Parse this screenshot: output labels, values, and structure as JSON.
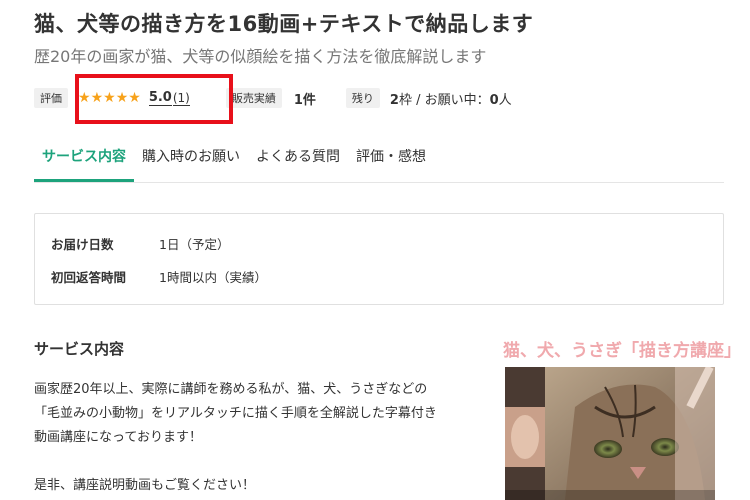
{
  "header": {
    "title": "猫、犬等の描き方を16動画+テキストで納品します",
    "subtitle": "歴20年の画家が猫、犬等の似顔絵を描く方法を徹底解説します"
  },
  "meta": {
    "rating_label": "評価",
    "rating_value": "5.0",
    "rating_count": "(1)",
    "rating_stars": 5,
    "star_color": "#f7a21b",
    "sales_label": "販売実績",
    "sales_value": "1件",
    "remaining_label": "残り",
    "remaining_slots": "2",
    "remaining_unit": "枠 / お願い中：",
    "requests_count": "0",
    "requests_unit": "人"
  },
  "tabs": [
    {
      "label": "サービス内容",
      "active": true
    },
    {
      "label": "購入時のお願い",
      "active": false
    },
    {
      "label": "よくある質問",
      "active": false
    },
    {
      "label": "評価・感想",
      "active": false
    }
  ],
  "accent_color": "#1da37c",
  "highlight_color": "#e8101a",
  "info": {
    "delivery_label": "お届け日数",
    "delivery_value": "1日（予定）",
    "response_label": "初回返答時間",
    "response_value": "1時間以内（実績）"
  },
  "service": {
    "heading": "サービス内容",
    "lines": [
      "画家歴20年以上、実際に講師を務める私が、猫、犬、うさぎなどの",
      "「毛並みの小動物」をリアルタッチに描く手順を全解説した字幕付き",
      "動画講座になっております！",
      "",
      "是非、講座説明動画もご覧ください！"
    ]
  },
  "thumbnail": {
    "title": "猫、犬、うさぎ「描き方講座」"
  }
}
